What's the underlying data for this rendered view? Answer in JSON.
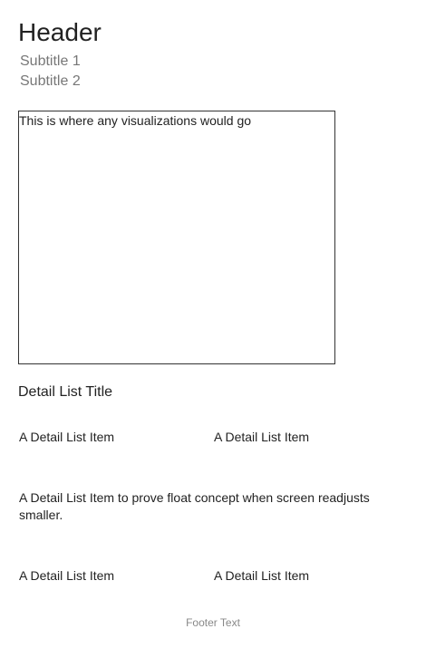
{
  "header": {
    "title": "Header"
  },
  "subtitles": [
    "Subtitle 1",
    "Subtitle 2"
  ],
  "visualization": {
    "placeholder_text": "This is where any visualizations would go"
  },
  "detail_list": {
    "title": "Detail List Title",
    "items": [
      "A Detail List Item",
      "A Detail List Item",
      "A Detail List Item to prove float concept when screen readjusts smaller.",
      "A Detail List Item",
      "A Detail List Item"
    ]
  },
  "footer": {
    "text": "Footer Text"
  }
}
